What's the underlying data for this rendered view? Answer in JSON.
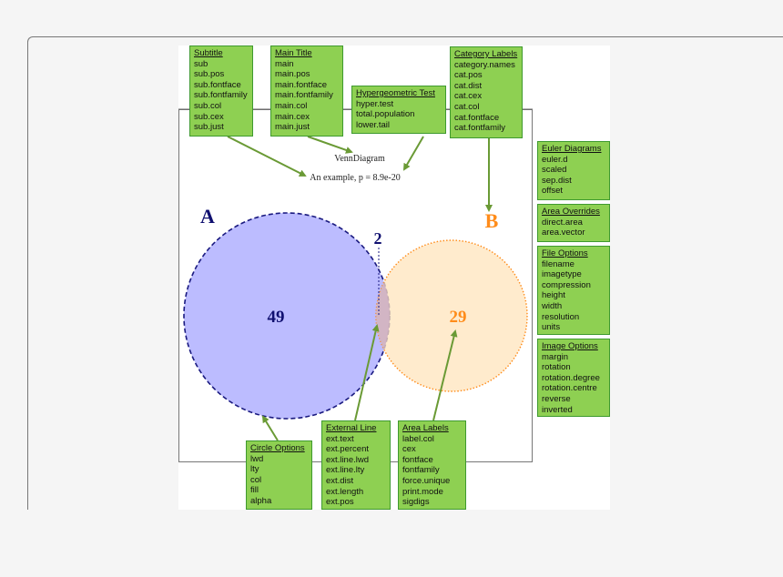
{
  "diagram": {
    "main_title": "VennDiagram",
    "subtitle": "An example, p = 8.9e-20",
    "category_labels": {
      "a": "A",
      "b": "B"
    },
    "area_labels": {
      "a_only": "49",
      "overlap": "2",
      "b_only": "29"
    },
    "colors": {
      "circle_a_fill": "#b8b8ff",
      "circle_a_stroke": "#1a1a80",
      "circle_b_fill": "#ffe4bc",
      "circle_b_stroke": "#ff8c1a",
      "label_a": "#101070",
      "label_b": "#ff8c1a",
      "box_fill": "#8ed052",
      "box_border": "#3f9a2f",
      "arrow": "#6a9a35"
    },
    "boxes": {
      "subtitle": {
        "title": "Subtitle",
        "items": [
          "sub",
          "sub.pos",
          "sub.fontface",
          "sub.fontfamily",
          "sub.col",
          "sub.cex",
          "sub.just"
        ]
      },
      "main_title": {
        "title": "Main Title",
        "items": [
          "main",
          "main.pos",
          "main.fontface",
          "main.fontfamily",
          "main.col",
          "main.cex",
          "main.just"
        ]
      },
      "hypergeometric": {
        "title": "Hypergeometric Test",
        "items": [
          "hyper.test",
          "total.population",
          "lower.tail"
        ]
      },
      "category_labels": {
        "title": "Category Labels",
        "items": [
          "category.names",
          "cat.pos",
          "cat.dist",
          "cat.cex",
          "cat.col",
          "cat.fontface",
          "cat.fontfamily"
        ]
      },
      "euler": {
        "title": "Euler Diagrams",
        "items": [
          "euler.d",
          "scaled",
          "sep.dist",
          "offset"
        ]
      },
      "area_overrides": {
        "title": "Area Overrides",
        "items": [
          "direct.area",
          "area.vector"
        ]
      },
      "file_options": {
        "title": "File Options",
        "items": [
          "filename",
          "imagetype",
          "compression",
          "height",
          "width",
          "resolution",
          "units"
        ]
      },
      "image_options": {
        "title": "Image Options",
        "items": [
          "margin",
          "rotation",
          "rotation.degree",
          "rotation.centre",
          "reverse",
          "inverted"
        ]
      },
      "circle_options": {
        "title": "Circle Options",
        "items": [
          "lwd",
          "lty",
          "col",
          "fill",
          "alpha"
        ]
      },
      "external_line": {
        "title": "External Line",
        "items": [
          "ext.text",
          "ext.percent",
          "ext.line.lwd",
          "ext.line.lty",
          "ext.dist",
          "ext.length",
          "ext.pos"
        ]
      },
      "area_labels": {
        "title": "Area Labels",
        "items": [
          "label.col",
          "cex",
          "fontface",
          "fontfamily",
          "force.unique",
          "print.mode",
          "sigdigs"
        ]
      }
    }
  }
}
